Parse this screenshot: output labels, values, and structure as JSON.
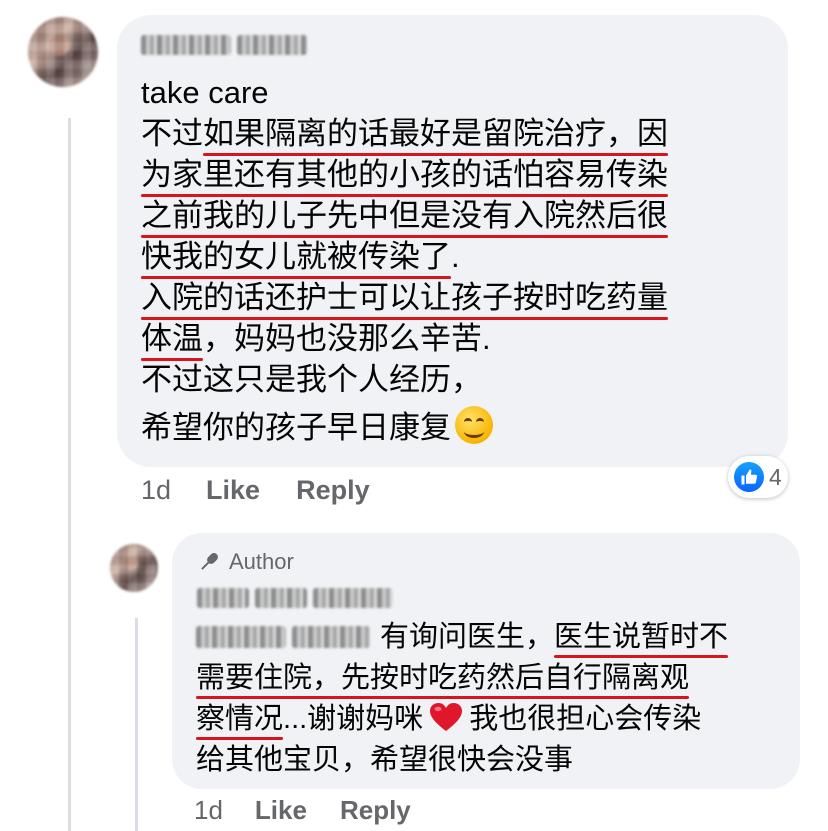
{
  "comment1": {
    "lines": [
      "take care",
      "不过如果隔离的话最好是留院治疗，因",
      "为家里还有其他的小孩的话怕容易传染",
      "之前我的儿子先中但是没有入院然后很",
      "快我的女儿就被传染了.",
      "入院的话还护士可以让孩子按时吃药量",
      "体温，妈妈也没那么辛苦.",
      "不过这只是我个人经历，",
      "希望你的孩子早日康复"
    ],
    "line1_pre": "不过",
    "line1_ul": "如果隔离的话最好是留院治疗，因",
    "line4_ul": "快我的女儿就被传染了",
    "line4_post": ".",
    "line6_ul": "体温",
    "line6_post": "，妈妈也没那么辛苦.",
    "emoji": "smiling-face",
    "time": "1d",
    "like_label": "Like",
    "reply_label": "Reply",
    "reaction_count": "4"
  },
  "comment2": {
    "badge": "Author",
    "line1_pre": "有询问医生，",
    "line1_ul": "医生说暂时不",
    "line2_ul": "需要住院，先按时吃药然后自行隔离观",
    "line3_ul": "察情况",
    "line3_post": "...谢谢妈咪",
    "line3_after_heart": "我也很担心会传染",
    "line4": "给其他宝贝，希望很快会没事",
    "time": "1d",
    "like_label": "Like",
    "reply_label": "Reply"
  },
  "colors": {
    "bubble": "#f0f2f5",
    "underline": "#d8141d",
    "meta": "#65676b",
    "like_blue": "#0866ff"
  }
}
